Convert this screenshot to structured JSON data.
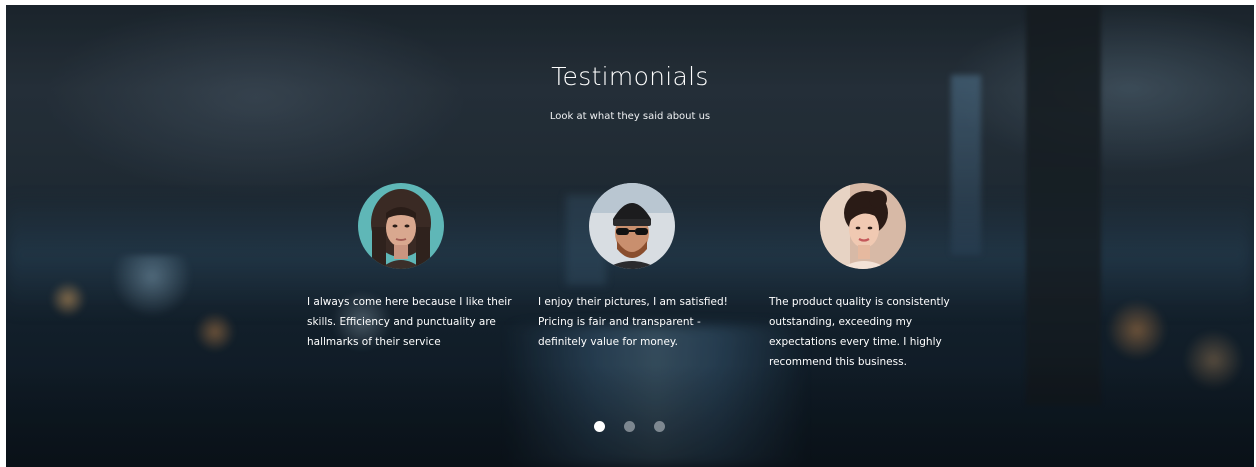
{
  "section": {
    "title": "Testimonials",
    "subtitle": "Look at what they said about us"
  },
  "testimonials": [
    {
      "quote": "I always come here because I like their skills. Efficiency and punctuality are hallmarks of their service",
      "avatar_icon": "woman-braids-avatar"
    },
    {
      "quote": "I enjoy their pictures, I am satisfied! Pricing is fair and transparent - definitely value for money.",
      "avatar_icon": "man-beanie-sunglasses-avatar"
    },
    {
      "quote": "The product quality is consistently outstanding, exceeding my expectations every time. I highly recommend this business.",
      "avatar_icon": "woman-bun-avatar"
    }
  ],
  "carousel": {
    "total_slides": 3,
    "active_slide": 1
  },
  "colors": {
    "text": "#ffffff",
    "dot_active": "#ffffff",
    "dot_inactive": "#c8ced4"
  }
}
